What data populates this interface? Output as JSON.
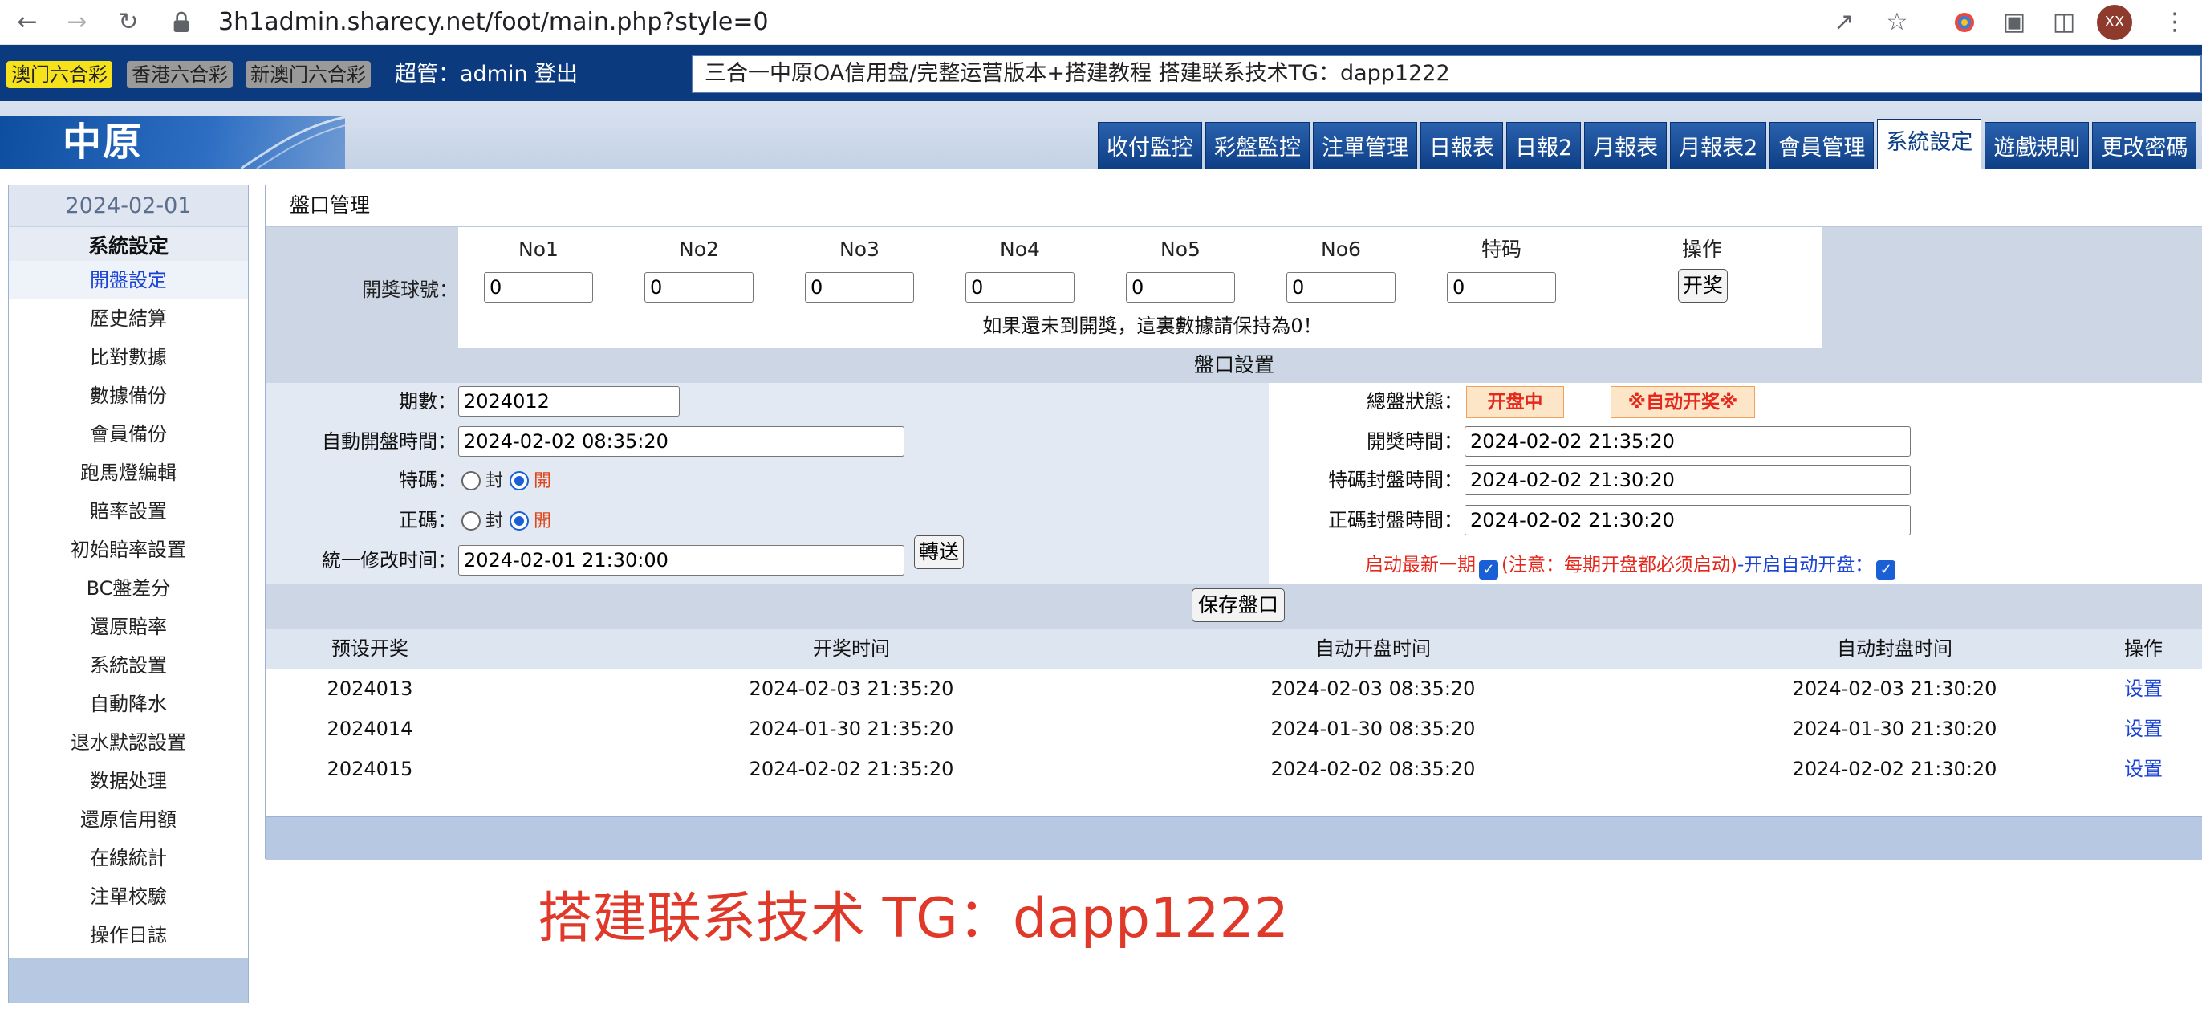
{
  "browser": {
    "url": "3h1admin.sharecy.net/foot/main.php?style=0",
    "profile_initials": "XX"
  },
  "header": {
    "lottery_tabs": [
      "澳门六合彩",
      "香港六合彩",
      "新澳门六合彩"
    ],
    "user_label": "超管：admin",
    "logout": "登出",
    "marquee": "三合一中原OA信用盘/完整运营版本+搭建教程 搭建联系技术TG：dapp1222"
  },
  "logo": {
    "text": "中原"
  },
  "menu": {
    "items": [
      "收付監控",
      "彩盤監控",
      "注單管理",
      "日報表",
      "日報2",
      "月報表",
      "月報表2",
      "會員管理",
      "系統設定",
      "遊戲規則",
      "更改密碼"
    ],
    "active": "系統設定"
  },
  "sidebar": {
    "date": "2024-02-01",
    "title": "系統設定",
    "items": [
      "開盤設定",
      "歷史結算",
      "比對數據",
      "數據備份",
      "會員備份",
      "跑馬燈編輯",
      "賠率設置",
      "初始賠率設置",
      "BC盤差分",
      "還原賠率",
      "系統設置",
      "自動降水",
      "退水默認設置",
      "数据处理",
      "還原信用額",
      "在線統計",
      "注單校驗",
      "操作日誌"
    ],
    "active_index": 0
  },
  "panel": {
    "title": "盤口管理",
    "draw": {
      "headers": [
        "No1",
        "No2",
        "No3",
        "No4",
        "No5",
        "No6",
        "特码",
        "操作"
      ],
      "label": "開獎球號：",
      "values": [
        "0",
        "0",
        "0",
        "0",
        "0",
        "0",
        "0"
      ],
      "button": "开奖",
      "note": "如果還未到開獎，這裏數據請保持為0！"
    },
    "settings": {
      "title": "盤口設置",
      "period_label": "期數：",
      "period_value": "2024012",
      "auto_open_label": "自動開盤時間：",
      "auto_open_value": "2024-02-02 08:35:20",
      "tema_label": "特碼：",
      "zhengma_label": "正碼：",
      "closed_label": "封",
      "open_label": "開",
      "unified_label": "統一修改时间：",
      "unified_value": "2024-02-01 21:30:00",
      "transfer_button": "轉送",
      "status_label": "總盤狀態：",
      "status_badge": "开盘中",
      "auto_draw_badge": "※自动开奖※",
      "draw_time_label": "開獎時間：",
      "draw_time_value": "2024-02-02 21:35:20",
      "tema_close_label": "特碼封盤時間：",
      "tema_close_value": "2024-02-02 21:30:20",
      "zhengma_close_label": "正碼封盤時間：",
      "zhengma_close_value": "2024-02-02 21:30:20",
      "auto_new_label": "启动最新一期",
      "auto_note": "(注意：每期开盘都必须启动)",
      "auto_open_switch": "-开启自动开盘："
    },
    "save_button": "保存盤口",
    "schedule": {
      "headers": [
        "预设开奖",
        "开奖时间",
        "自动开盘时间",
        "自动封盘时间",
        "操作"
      ],
      "rows": [
        [
          "2024013",
          "2024-02-03 21:35:20",
          "2024-02-03 08:35:20",
          "2024-02-03 21:30:20",
          "设置"
        ],
        [
          "2024014",
          "2024-01-30 21:35:20",
          "2024-01-30 08:35:20",
          "2024-01-30 21:30:20",
          "设置"
        ],
        [
          "2024015",
          "2024-02-02 21:35:20",
          "2024-02-02 08:35:20",
          "2024-02-02 21:30:20",
          "设置"
        ]
      ]
    }
  },
  "watermark": "搭建联系技术 TG：dapp1222",
  "colors": {
    "header_blue": "#0b3a7e",
    "accent_yellow": "#f5e21d",
    "link_blue": "#1b43d4",
    "watermark_red": "#e0392a",
    "status_red": "#e5281b"
  }
}
